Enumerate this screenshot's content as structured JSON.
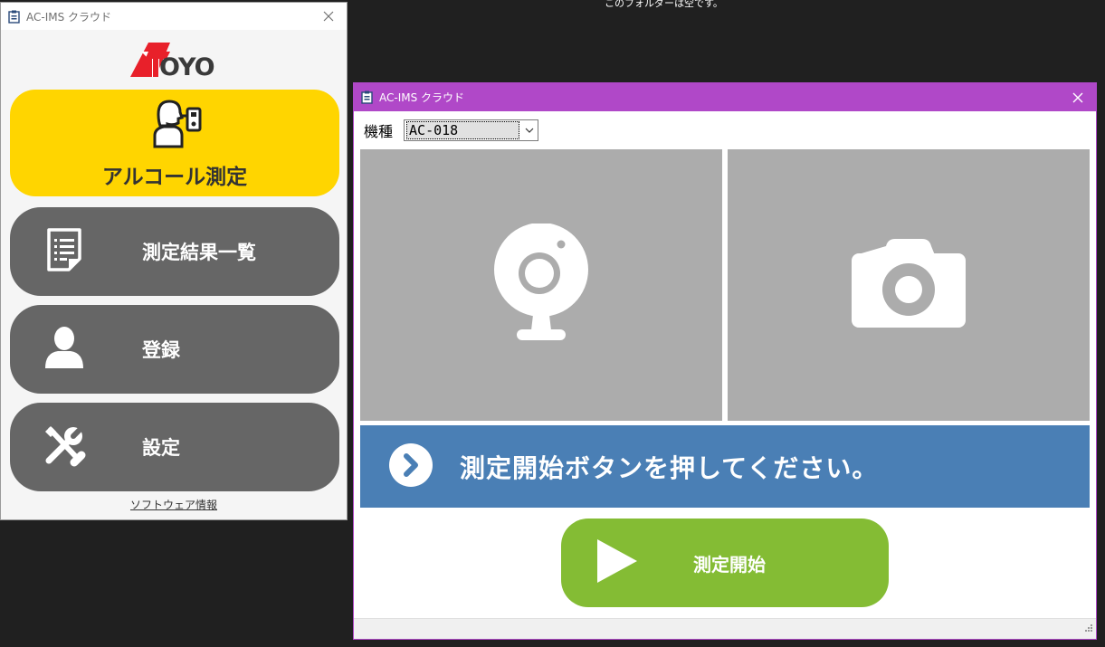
{
  "desktop": {
    "folder_empty_text": "このフォルダーは空です。"
  },
  "left_window": {
    "title": "AC-IMS クラウド",
    "logo_text": "TOYO",
    "buttons": {
      "alcohol": "アルコール測定",
      "results": "測定結果一覧",
      "register": "登録",
      "settings": "設定"
    },
    "software_info_link": "ソフトウェア情報"
  },
  "right_window": {
    "title": "AC-IMS クラウド",
    "model_label": "機種",
    "model_selected": "AC-018",
    "message": "測定開始ボタンを押してください。",
    "start_button": "測定開始"
  },
  "colors": {
    "alcohol_button": "#ffd500",
    "menu_button": "#666666",
    "titlebar_accent": "#b048c8",
    "message_bar": "#4a7fb5",
    "start_button": "#84bc34",
    "panel": "#acacac",
    "logo_red": "#e8202a"
  },
  "icons": {
    "alcohol": "person-breathalyzer-icon",
    "results": "document-list-icon",
    "register": "person-icon",
    "settings": "tools-icon",
    "webcam": "webcam-icon",
    "camera": "camera-icon",
    "message": "chevron-right-circle-icon",
    "start": "play-icon"
  }
}
